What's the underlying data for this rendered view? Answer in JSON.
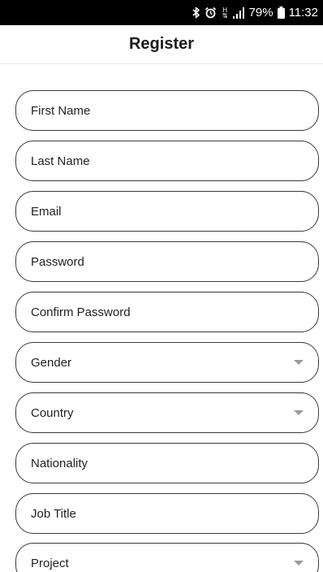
{
  "status_bar": {
    "icons": [
      "bluetooth-icon",
      "alarm-icon",
      "hplus-network-icon",
      "signal-icon",
      "battery-icon"
    ],
    "network_type": "H",
    "battery_percent": "79%",
    "time": "11:32"
  },
  "app_bar": {
    "title": "Register"
  },
  "form": {
    "first_name": {
      "placeholder": "First Name"
    },
    "last_name": {
      "placeholder": "Last Name"
    },
    "email": {
      "placeholder": "Email"
    },
    "password": {
      "placeholder": "Password"
    },
    "confirm_password": {
      "placeholder": "Confirm Password"
    },
    "gender": {
      "placeholder": "Gender"
    },
    "country": {
      "placeholder": "Country"
    },
    "nationality": {
      "placeholder": "Nationality"
    },
    "job_title": {
      "placeholder": "Job Title"
    },
    "project": {
      "placeholder": "Project"
    }
  },
  "colors": {
    "status_bar_bg": "#000000",
    "field_border": "#3a3a3a",
    "caret": "#9a9a9a"
  }
}
